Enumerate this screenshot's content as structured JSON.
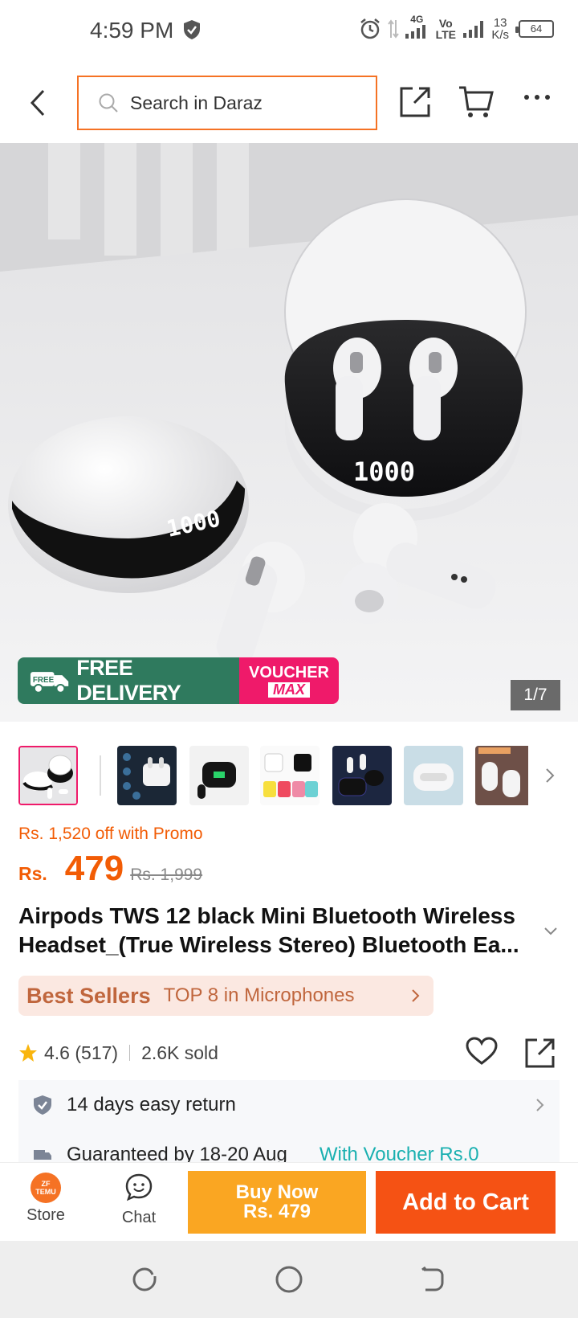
{
  "status_bar": {
    "time": "4:59 PM",
    "network": "4G",
    "volte": "Vo LTE",
    "speed_value": "13",
    "speed_unit": "K/s",
    "battery": "64"
  },
  "header": {
    "search_placeholder": "Search in Daraz"
  },
  "hero": {
    "free_delivery": "FREE DELIVERY",
    "free_tag": "FREE",
    "voucher_line1": "VOUCHER",
    "voucher_line2": "MAX",
    "counter": "1/7"
  },
  "thumbnails": [
    {
      "name": "thumb-1",
      "selected": true
    },
    {
      "name": "thumb-2"
    },
    {
      "name": "thumb-3"
    },
    {
      "name": "thumb-4"
    },
    {
      "name": "thumb-5"
    },
    {
      "name": "thumb-6"
    },
    {
      "name": "thumb-7"
    }
  ],
  "product": {
    "promo": "Rs. 1,520 off with Promo",
    "currency": "Rs.",
    "price": "479",
    "old_price": "Rs. 1,999",
    "title": "Airpods TWS 12 black Mini Bluetooth Wireless Headset_(True Wireless Stereo) Bluetooth Ea...",
    "bestseller_label": "Best Sellers",
    "bestseller_text": "TOP 8 in Microphones",
    "rating": "4.6 (517)",
    "sold": "2.6K sold"
  },
  "services": {
    "return": "14 days easy return",
    "guarantee": "Guaranteed by 18-20 Aug",
    "voucher": "With Voucher Rs.0"
  },
  "bottom_bar": {
    "store_label": "Store",
    "store_logo": "ZF TEMU",
    "chat_label": "Chat",
    "buy_now_line1": "Buy Now",
    "buy_now_line2": "Rs. 479",
    "add_to_cart": "Add to Cart"
  },
  "colors": {
    "accent": "#f57224",
    "price": "#f25c05",
    "buy_now": "#faa622",
    "add_to_cart": "#f55214",
    "free_delivery": "#2f7a5e",
    "voucher": "#ef1a6a"
  }
}
